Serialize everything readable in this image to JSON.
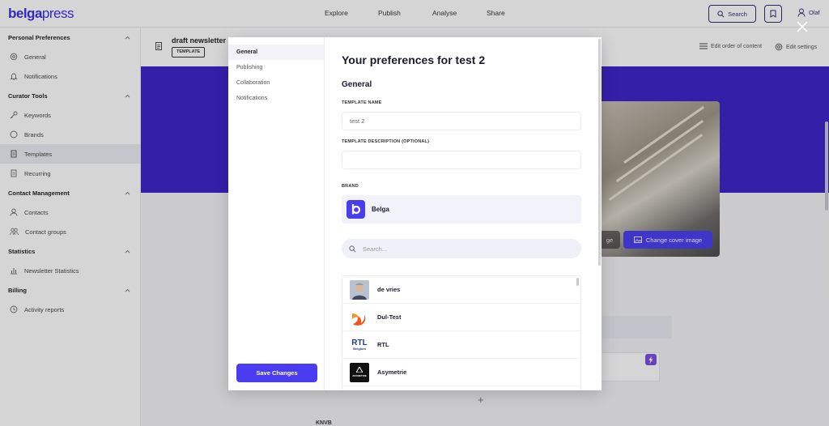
{
  "app": {
    "logo_main": "belga",
    "logo_sub": "press"
  },
  "topnav": {
    "items": [
      "Explore",
      "Publish",
      "Analyse",
      "Share"
    ],
    "search_label": "Search",
    "user_name": "Olaf"
  },
  "sidebar": {
    "sections": [
      {
        "title": "Personal Preferences",
        "items": [
          "General",
          "Notifications"
        ]
      },
      {
        "title": "Curator Tools",
        "items": [
          "Keywords",
          "Brands",
          "Templates",
          "Recurring"
        ]
      },
      {
        "title": "Contact Management",
        "items": [
          "Contacts",
          "Contact groups"
        ]
      },
      {
        "title": "Statistics",
        "items": [
          "Newsletter Statistics"
        ]
      },
      {
        "title": "Billing",
        "items": [
          "Activity reports"
        ]
      }
    ],
    "active_item": "Templates"
  },
  "document": {
    "title": "draft newsletter",
    "badge": "TEMPLATE",
    "edit_order_label": "Edit order of content",
    "edit_settings_label": "Edit settings",
    "change_image_partial": "ge",
    "change_cover_label": "Change cover image",
    "bottom_text": "KNVB"
  },
  "modal": {
    "nav": [
      "General",
      "Publishing",
      "Collaboration",
      "Notifications"
    ],
    "active_nav": "General",
    "save_label": "Save Changes",
    "title": "Your preferences for test 2",
    "section_title": "General",
    "template_name_label": "TEMPLATE NAME",
    "template_name_value": "test 2",
    "template_desc_label": "TEMPLATE DESCRIPTION (OPTIONAL)",
    "template_desc_value": "",
    "brand_label": "BRAND",
    "selected_brand": "Belga",
    "search_placeholder": "Search...",
    "brands": [
      "de vries",
      "Dul-Test",
      "RTL",
      "Asymetrie"
    ],
    "rtl_logo_text": "RTL",
    "rtl_logo_sub": "Belgium",
    "asymetrie_logo_text": "ASYMETRIE"
  },
  "colors": {
    "accent": "#4a3cf0",
    "banner": "#3b22c9"
  }
}
